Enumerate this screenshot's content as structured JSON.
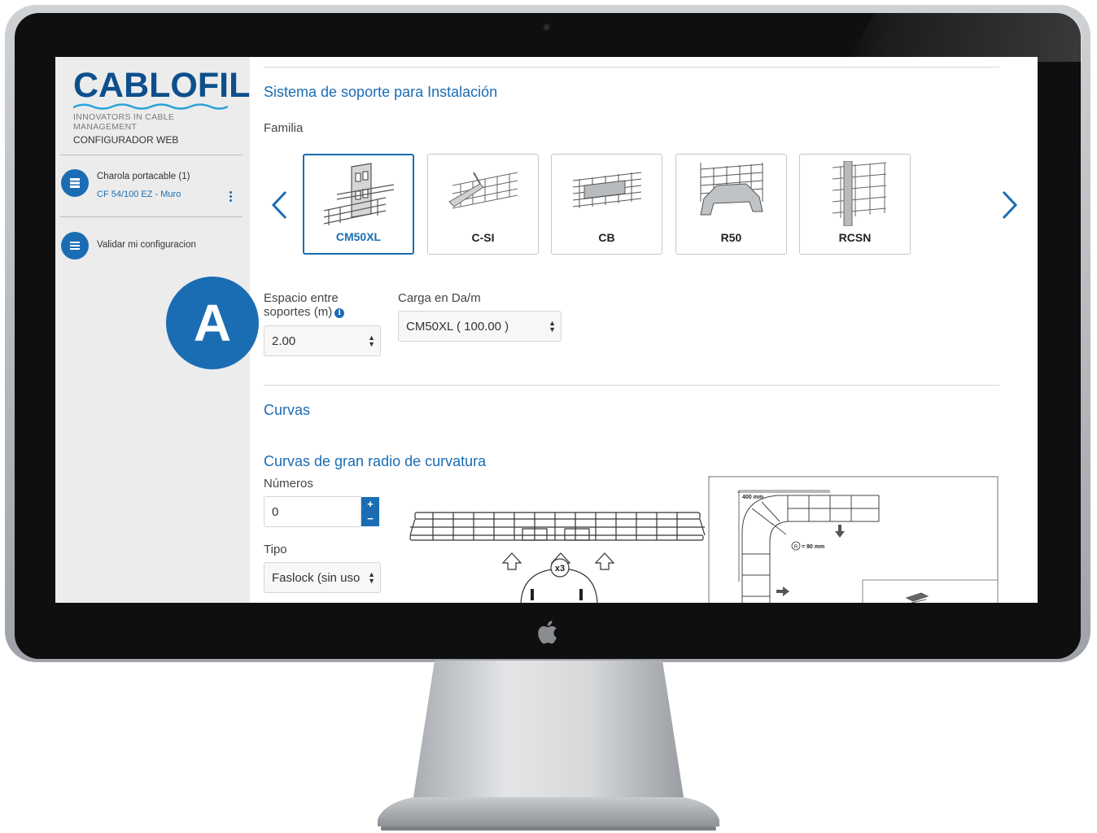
{
  "sidebar": {
    "brand_name": "CABLOFIL",
    "brand_tagline": "INNOVATORS IN CABLE MANAGEMENT",
    "brand_subtitle": "CONFIGURADOR WEB",
    "items": [
      {
        "title": "Charola portacable (1)",
        "subtitle": "CF 54/100 EZ - Muro",
        "icon": "tray-icon"
      },
      {
        "title": "Validar mi configuracion",
        "icon": "list-icon"
      }
    ]
  },
  "support": {
    "title": "Sistema de soporte para Instalación",
    "family_label": "Familia",
    "families": [
      {
        "label": "CM50XL",
        "selected": true
      },
      {
        "label": "C-SI",
        "selected": false
      },
      {
        "label": "CB",
        "selected": false
      },
      {
        "label": "R50",
        "selected": false
      },
      {
        "label": "RCSN",
        "selected": false
      }
    ],
    "spacing_label_line1": "Espacio entre",
    "spacing_label_line2": "soportes (m)",
    "spacing_value": "2.00",
    "load_label": "Carga en Da/m",
    "load_value": "CM50XL ( 100.00 )"
  },
  "curves": {
    "title": "Curvas",
    "subtitle": "Curvas de gran radio de curvatura",
    "numbers_label": "Números",
    "numbers_value": "0",
    "type_label": "Tipo",
    "type_value": "Faslock (sin uso"
  },
  "diagram": {
    "multiplier": "x3",
    "dim_length": "400 mm",
    "radius_label": "R",
    "radius_value": "= 90 mm"
  },
  "callout": "A",
  "colors": {
    "accent": "#1b6db3",
    "brand": "#0d4f8c",
    "sidebar_bg": "#ececec",
    "bezel": "#0f0f10"
  }
}
